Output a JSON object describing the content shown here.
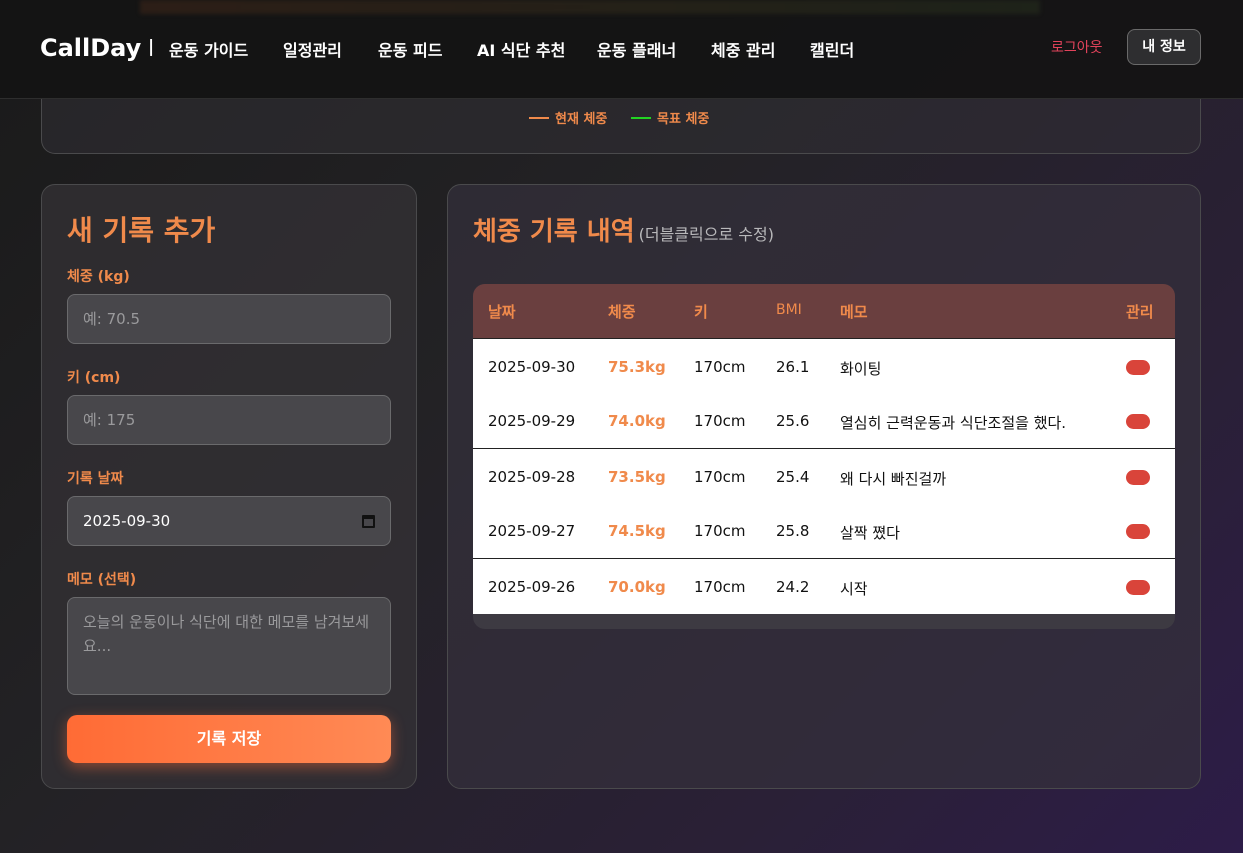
{
  "header": {
    "logo": "CallDay",
    "separator": "|",
    "nav": [
      "운동 가이드",
      "일정관리",
      "운동 피드",
      "AI 식단 추천",
      "운동 플래너",
      "체중 관리",
      "캘린더"
    ],
    "logout": "로그아웃",
    "my_info": "내 정보"
  },
  "chart_legend": {
    "current": "현재 체중",
    "target": "목표 체중",
    "current_color": "#f08a4b",
    "target_color": "#22d422"
  },
  "form": {
    "title": "새 기록 추가",
    "weight_label": "체중 (kg)",
    "weight_placeholder": "예: 70.5",
    "height_label": "키 (cm)",
    "height_placeholder": "예: 175",
    "date_label": "기록 날짜",
    "date_value": "2025-09-30",
    "memo_label": "메모 (선택)",
    "memo_placeholder": "오늘의 운동이나 식단에 대한 메모를 남겨보세요...",
    "save_label": "기록 저장"
  },
  "history": {
    "title": "체중 기록 내역",
    "subtitle": "(더블클릭으로 수정)",
    "columns": [
      "날짜",
      "체중",
      "키",
      "BMI",
      "메모",
      "관리"
    ],
    "rows": [
      {
        "date": "2025-09-30",
        "weight": "75.3kg",
        "height": "170cm",
        "bmi": "26.1",
        "memo": "화이팅"
      },
      {
        "date": "2025-09-29",
        "weight": "74.0kg",
        "height": "170cm",
        "bmi": "25.6",
        "memo": "열심히 근력운동과 식단조절을 했다."
      },
      {
        "date": "2025-09-28",
        "weight": "73.5kg",
        "height": "170cm",
        "bmi": "25.4",
        "memo": "왜 다시 빠진걸까"
      },
      {
        "date": "2025-09-27",
        "weight": "74.5kg",
        "height": "170cm",
        "bmi": "25.8",
        "memo": "살짝 쪘다"
      },
      {
        "date": "2025-09-26",
        "weight": "70.0kg",
        "height": "170cm",
        "bmi": "24.2",
        "memo": "시작"
      }
    ]
  },
  "colors": {
    "accent": "#f08a4b",
    "button_gradient_start": "#ff6b35",
    "delete": "#d9443a",
    "logout": "#e2435b"
  }
}
